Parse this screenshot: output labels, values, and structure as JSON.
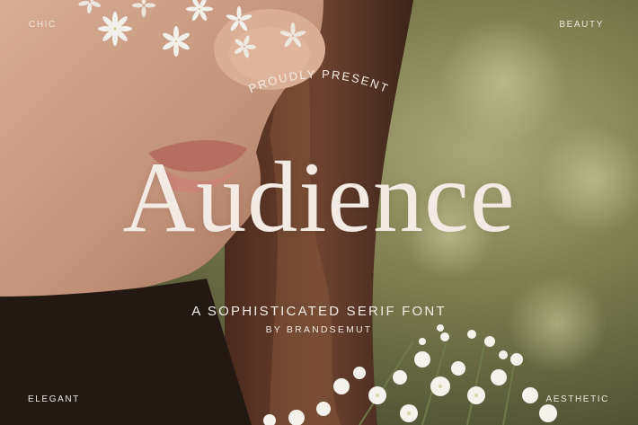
{
  "corners": {
    "top_left": "CHIC",
    "top_right": "BEAUTY",
    "bottom_left": "ELEGANT",
    "bottom_right": "AESTHETIC"
  },
  "intro": "PROUDLY PRESENT",
  "title": "Audience",
  "tagline": "A SOPHISTICATED SERIF FONT",
  "byline": "BY BRANDSEMUT",
  "colors": {
    "text": "#f3ebe3",
    "skin": "#c99a80",
    "hair": "#5b3524",
    "foliage": "#7c7c4e"
  }
}
